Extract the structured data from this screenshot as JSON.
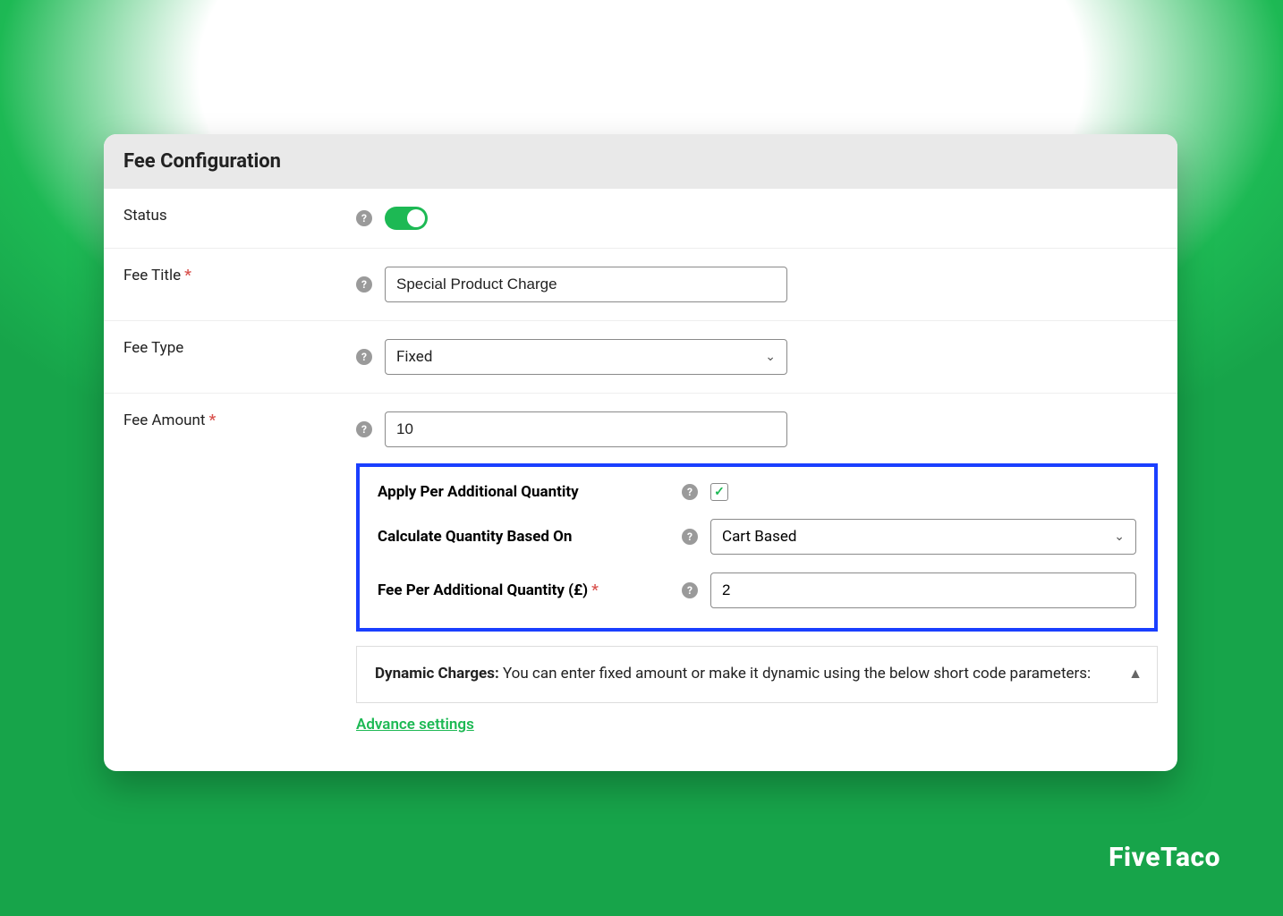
{
  "panel": {
    "title": "Fee Configuration"
  },
  "rows": {
    "status": {
      "label": "Status",
      "enabled": true
    },
    "fee_title": {
      "label": "Fee Title",
      "required_marker": "*",
      "value": "Special Product Charge"
    },
    "fee_type": {
      "label": "Fee Type",
      "value": "Fixed"
    },
    "fee_amount": {
      "label": "Fee Amount",
      "required_marker": "*",
      "value": "10"
    }
  },
  "additional": {
    "apply_per_qty": {
      "label": "Apply Per Additional Quantity",
      "checked": true
    },
    "calc_based_on": {
      "label": "Calculate Quantity Based On",
      "value": "Cart Based"
    },
    "fee_per_qty": {
      "label": "Fee Per Additional Quantity (£)",
      "required_marker": "*",
      "value": "2"
    }
  },
  "info": {
    "strong": "Dynamic Charges:",
    "text": " You can enter fixed amount or make it dynamic using the below short code parameters:"
  },
  "advance_link": "Advance settings",
  "brand": "FiveTaco"
}
